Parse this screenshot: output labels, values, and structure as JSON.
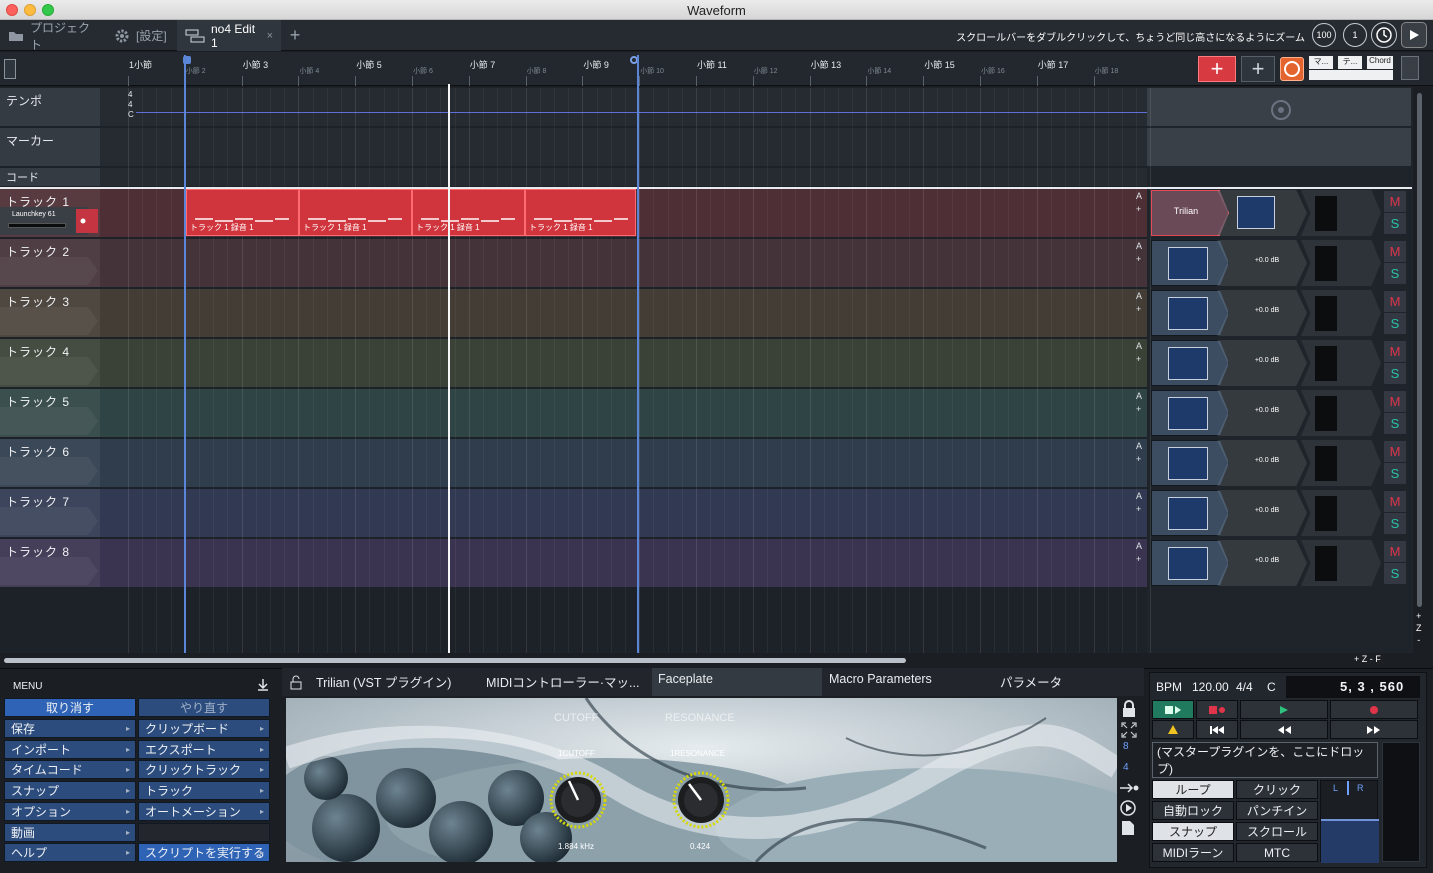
{
  "window": {
    "title": "Waveform"
  },
  "tabs": [
    {
      "label": "プロジェクト",
      "icon": "folder-icon"
    },
    {
      "label": "[設定]",
      "icon": "gear-icon"
    },
    {
      "label": "no4 Edit 1",
      "icon": "edit-icon",
      "active": true
    }
  ],
  "tab_add": "+",
  "tab_close": "×",
  "toolbar": {
    "hint": "スクロールバーをダブルクリックして、ちょうど同じ高さになるようにズーム",
    "zoom_value": "100",
    "count_value": "1"
  },
  "ruler": {
    "major": [
      "1小節",
      "小節 3",
      "小節 5",
      "小節 7",
      "小節 9",
      "小節 11",
      "小節 13",
      "小節 15",
      "小節 17"
    ],
    "minor": [
      "小節 2",
      "小節 4",
      "小節 6",
      "小節 8",
      "小節 10",
      "小節 12",
      "小節 14",
      "小節 16",
      "小節 18"
    ],
    "top_right_buttons": [
      "マ...",
      "テ...",
      "Chord"
    ]
  },
  "lanes": {
    "tempo": "テンポ",
    "marker": "マーカー",
    "chord": "コード",
    "time_sig": [
      "4",
      "4",
      "C"
    ]
  },
  "tracks": [
    {
      "name": "トラック 1",
      "input": "Launchkey 61",
      "color": "#4d2f35",
      "plugin": "Trilian",
      "mute": "M",
      "solo": "S",
      "auto": "A"
    },
    {
      "name": "トラック 2",
      "color": "#44343a",
      "volume": "+0.0 dB",
      "mute": "M",
      "solo": "S",
      "auto": "A"
    },
    {
      "name": "トラック 3",
      "color": "#433d36",
      "volume": "+0.0 dB",
      "mute": "M",
      "solo": "S",
      "auto": "A"
    },
    {
      "name": "トラック 4",
      "color": "#3a4237",
      "volume": "+0.0 dB",
      "mute": "M",
      "solo": "S",
      "auto": "A"
    },
    {
      "name": "トラック 5",
      "color": "#2f4444",
      "volume": "+0.0 dB",
      "mute": "M",
      "solo": "S",
      "auto": "A"
    },
    {
      "name": "トラック 6",
      "color": "#2f3d4d",
      "volume": "+0.0 dB",
      "mute": "M",
      "solo": "S",
      "auto": "A"
    },
    {
      "name": "トラック 7",
      "color": "#313a52",
      "volume": "+0.0 dB",
      "mute": "M",
      "solo": "S",
      "auto": "A"
    },
    {
      "name": "トラック 8",
      "color": "#3a3450",
      "volume": "+0.0 dB",
      "mute": "M",
      "solo": "S",
      "auto": "A"
    }
  ],
  "clips": [
    "トラック 1 録音 1",
    "トラック 1 録音 1",
    "トラック 1 録音 1",
    "トラック 1 録音 1"
  ],
  "zoom_controls": "+ Z - F",
  "menu": {
    "title": "MENU",
    "undo": "取り消す",
    "redo": "やり直す",
    "left": [
      "保存",
      "インポート",
      "タイムコード",
      "スナップ",
      "オプション",
      "動画",
      "ヘルプ"
    ],
    "right": [
      "クリップボード",
      "エクスポート",
      "クリックトラック",
      "トラック",
      "オートメーション",
      "",
      "スクリプトを実行する"
    ]
  },
  "plugin_panel": {
    "tabs": [
      "Trilian (VST プラグイン)",
      "MIDIコントローラー·マッ...",
      "Faceplate",
      "Macro Parameters",
      "パラメータ"
    ],
    "knobs": [
      {
        "title": "CUTOFF",
        "label": "1CUTOFF",
        "value": "1.884 kHz"
      },
      {
        "title": "RESONANCE",
        "label": "1RESONANCE",
        "value": "0.424"
      }
    ],
    "side_numbers": [
      "8",
      "4"
    ]
  },
  "transport": {
    "bpm": "BPM",
    "bpm_value": "120.00",
    "sig": "4/4",
    "key": "C",
    "position": "5, 3 , 560",
    "master_drop": "(マスタープラグインを、ここにドロップ)",
    "buttons_left": [
      "ループ",
      "自動ロック",
      "スナップ",
      "MIDIラーン"
    ],
    "buttons_right": [
      "クリック",
      "パンチイン",
      "スクロール",
      "MTC"
    ],
    "meter_l": "L",
    "meter_r": "R"
  }
}
